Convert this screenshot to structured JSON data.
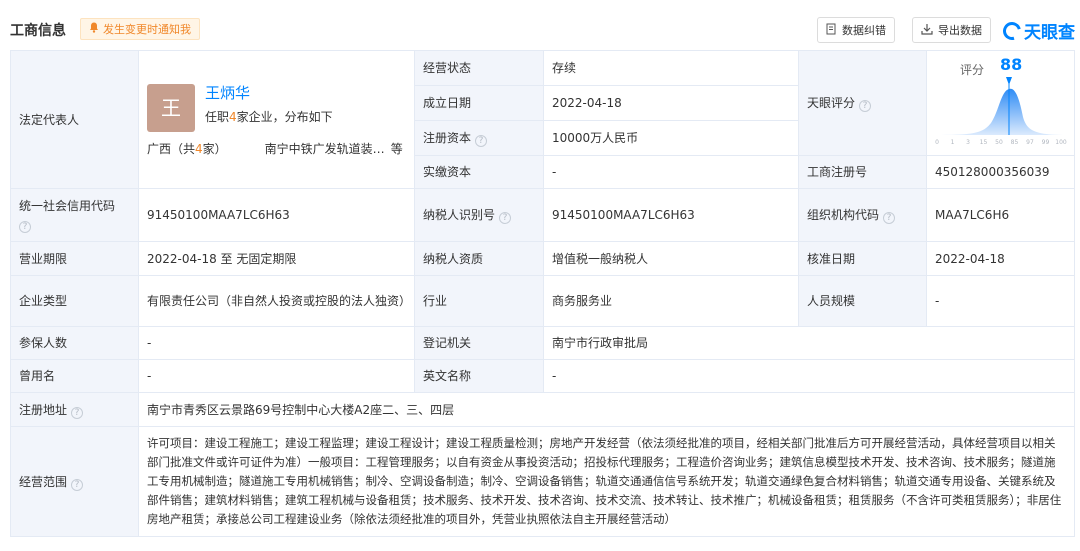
{
  "header": {
    "title": "工商信息",
    "notify_label": "发生变更时通知我",
    "correct_label": "数据纠错",
    "export_label": "导出数据",
    "brand": "天眼查"
  },
  "legal_rep": {
    "label": "法定代表人",
    "avatar_char": "王",
    "name": "王炳华",
    "sub_prefix": "任职",
    "sub_count": "4",
    "sub_suffix": "家企业，分布如下",
    "region_prefix": "广西（共",
    "region_count": "4",
    "region_suffix": "家）",
    "company": "南宁中铁广发轨道装…",
    "more": "等"
  },
  "fields": {
    "status_label": "经营状态",
    "status_value": "存续",
    "founded_label": "成立日期",
    "founded_value": "2022-04-18",
    "reg_capital_label": "注册资本",
    "reg_capital_value": "10000万人民币",
    "paid_capital_label": "实缴资本",
    "paid_capital_value": "-",
    "score_label": "天眼评分",
    "reg_no_label": "工商注册号",
    "reg_no_value": "450128000356039",
    "credit_code_label": "统一社会信用代码",
    "credit_code_value": "91450100MAA7LC6H63",
    "taxpayer_id_label": "纳税人识别号",
    "taxpayer_id_value": "91450100MAA7LC6H63",
    "org_code_label": "组织机构代码",
    "org_code_value": "MAA7LC6H6",
    "term_label": "营业期限",
    "term_value": "2022-04-18 至 无固定期限",
    "taxpayer_qual_label": "纳税人资质",
    "taxpayer_qual_value": "增值税一般纳税人",
    "approval_date_label": "核准日期",
    "approval_date_value": "2022-04-18",
    "type_label": "企业类型",
    "type_value": "有限责任公司（非自然人投资或控股的法人独资）",
    "industry_label": "行业",
    "industry_value": "商务服务业",
    "staff_label": "人员规模",
    "staff_value": "-",
    "insured_label": "参保人数",
    "insured_value": "-",
    "authority_label": "登记机关",
    "authority_value": "南宁市行政审批局",
    "former_name_label": "曾用名",
    "former_name_value": "-",
    "english_label": "英文名称",
    "english_value": "-",
    "address_label": "注册地址",
    "address_value": "南宁市青秀区云景路69号控制中心大楼A2座二、三、四层",
    "scope_label": "经营范围",
    "scope_value": "许可项目：建设工程施工；建设工程监理；建设工程设计；建设工程质量检测；房地产开发经营（依法须经批准的项目，经相关部门批准后方可开展经营活动，具体经营项目以相关部门批准文件或许可证件为准）一般项目：工程管理服务；以自有资金从事投资活动；招投标代理服务；工程造价咨询业务；建筑信息模型技术开发、技术咨询、技术服务；隧道施工专用机械制造；隧道施工专用机械销售；制冷、空调设备制造；制冷、空调设备销售；轨道交通通信信号系统开发；轨道交通绿色复合材料销售；轨道交通专用设备、关键系统及部件销售；建筑材料销售；建筑工程机械与设备租赁；技术服务、技术开发、技术咨询、技术交流、技术转让、技术推广；机械设备租赁；租赁服务（不含许可类租赁服务）；非居住房地产租赁；承接总公司工程建设业务（除依法须经批准的项目外，凭营业执照依法自主开展经营活动）"
  },
  "score": {
    "prefix": "评分",
    "value": 88,
    "axis_ticks": [
      "0",
      "1",
      "3",
      "15",
      "50",
      "85",
      "97",
      "99",
      "100"
    ]
  },
  "colors": {
    "accent": "#0084ff",
    "label_bg": "#f2f5fb",
    "border": "#e4eaf4",
    "orange": "#f0882b"
  }
}
